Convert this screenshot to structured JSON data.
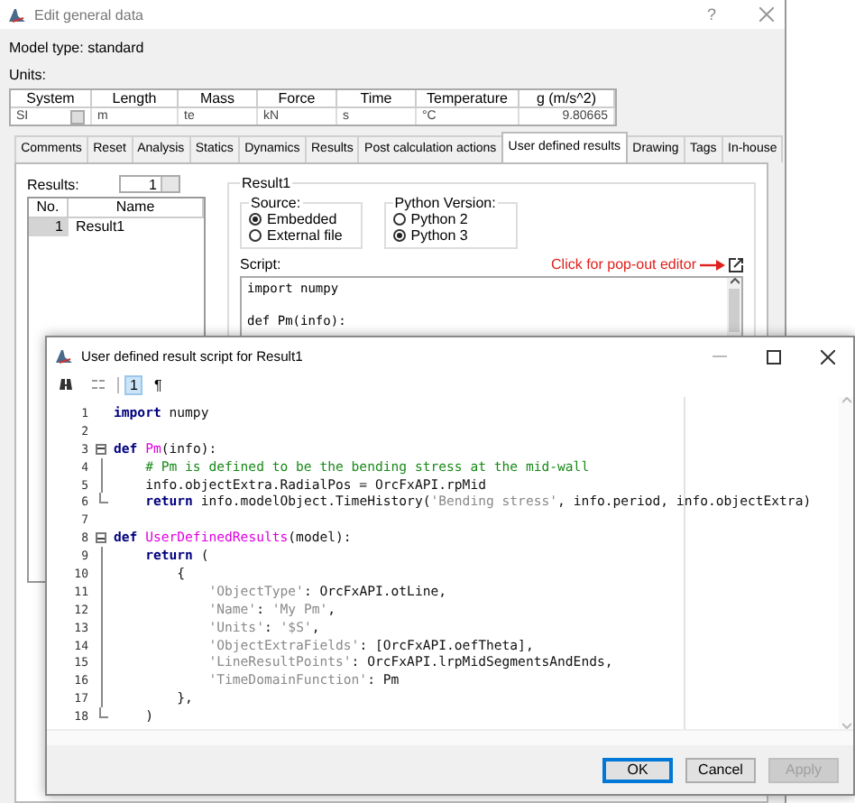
{
  "main_window": {
    "title": "Edit general data",
    "help": "?",
    "model_type": "Model type: standard",
    "units_label": "Units:",
    "units": [
      {
        "header": "System",
        "value": "SI",
        "kind": "dropdown"
      },
      {
        "header": "Length",
        "value": "m",
        "kind": "text"
      },
      {
        "header": "Mass",
        "value": "te",
        "kind": "text"
      },
      {
        "header": "Force",
        "value": "kN",
        "kind": "text"
      },
      {
        "header": "Time",
        "value": "s",
        "kind": "text"
      },
      {
        "header": "Temperature",
        "value": "°C",
        "kind": "text"
      },
      {
        "header": "g (m/s^2)",
        "value": "9.80665",
        "kind": "number"
      }
    ],
    "tabs": [
      {
        "label": "Comments",
        "selected": false
      },
      {
        "label": "Reset",
        "selected": false
      },
      {
        "label": "Analysis",
        "selected": false
      },
      {
        "label": "Statics",
        "selected": false
      },
      {
        "label": "Dynamics",
        "selected": false
      },
      {
        "label": "Results",
        "selected": false
      },
      {
        "label": "Post calculation actions",
        "selected": false
      },
      {
        "label": "User defined results",
        "selected": true
      },
      {
        "label": "Drawing",
        "selected": false
      },
      {
        "label": "Tags",
        "selected": false
      },
      {
        "label": "In-house",
        "selected": false
      }
    ],
    "results_label": "Results:",
    "results_count": "1",
    "results_list": {
      "columns": [
        "No.",
        "Name"
      ],
      "rows": [
        {
          "no": "1",
          "name": "Result1",
          "selected": true
        }
      ]
    },
    "result_group": {
      "title": "Result1",
      "source": {
        "title": "Source:",
        "options": [
          {
            "label": "Embedded",
            "selected": true
          },
          {
            "label": "External file",
            "selected": false
          }
        ]
      },
      "python_version": {
        "title": "Python Version:",
        "options": [
          {
            "label": "Python 2",
            "selected": false
          },
          {
            "label": "Python 3",
            "selected": true
          }
        ]
      },
      "script_label": "Script:",
      "popout_hint": "Click for pop-out editor",
      "script_blocks": [
        [
          "import numpy"
        ],
        [
          "def Pm(info):"
        ]
      ]
    }
  },
  "editor_window": {
    "title": "User defined result script for Result1",
    "toolbar": [
      {
        "kind": "find",
        "selected": false
      },
      {
        "kind": "replace",
        "selected": false
      },
      {
        "kind": "toggle",
        "label": "1",
        "selected": true
      },
      {
        "kind": "toggle",
        "label": "¶",
        "selected": false
      }
    ],
    "lines": [
      {
        "number": "1",
        "kind": "plain",
        "tokens": [
          {
            "kind": "keyword",
            "text": "import"
          },
          {
            "kind": "plain",
            "text": " numpy"
          }
        ]
      },
      {
        "number": "2",
        "kind": "plain"
      },
      {
        "number": "3",
        "kind": "fold_start",
        "tokens": [
          {
            "kind": "keyword",
            "text": "def "
          },
          {
            "kind": "function",
            "text": "Pm"
          },
          {
            "kind": "plain",
            "text": "(info):"
          }
        ]
      },
      {
        "number": "4",
        "kind": "fold_body",
        "tokens": [
          {
            "kind": "comment",
            "text": "    # Pm is defined to be the bending stress at the mid-wall"
          }
        ]
      },
      {
        "number": "5",
        "kind": "fold_body",
        "tokens": [
          {
            "kind": "plain",
            "text": "    info.objectExtra.RadialPos = OrcFxAPI.rpMid"
          }
        ]
      },
      {
        "number": "6",
        "kind": "fold_end",
        "tokens": [
          {
            "kind": "keyword",
            "text": "    return"
          },
          {
            "kind": "plain",
            "text": " info.modelObject.TimeHistory("
          },
          {
            "kind": "string",
            "text": "'Bending stress'"
          },
          {
            "kind": "plain",
            "text": ", info.period, info.objectExtra)"
          }
        ]
      },
      {
        "number": "7",
        "kind": "plain"
      },
      {
        "number": "8",
        "kind": "fold_start",
        "tokens": [
          {
            "kind": "keyword",
            "text": "def "
          },
          {
            "kind": "function",
            "text": "UserDefinedResults"
          },
          {
            "kind": "plain",
            "text": "(model):"
          }
        ]
      },
      {
        "number": "9",
        "kind": "fold_body",
        "tokens": [
          {
            "kind": "keyword",
            "text": "    return"
          },
          {
            "kind": "plain",
            "text": " ("
          }
        ]
      },
      {
        "number": "10",
        "kind": "fold_body",
        "tokens": [
          {
            "kind": "plain",
            "text": "        {"
          }
        ]
      },
      {
        "number": "11",
        "kind": "fold_body",
        "tokens": [
          {
            "kind": "string",
            "text": "            'ObjectType'"
          },
          {
            "kind": "plain",
            "text": ": OrcFxAPI.otLine,"
          }
        ]
      },
      {
        "number": "12",
        "kind": "fold_body",
        "tokens": [
          {
            "kind": "string",
            "text": "            'Name'"
          },
          {
            "kind": "plain",
            "text": ": "
          },
          {
            "kind": "string",
            "text": "'My Pm'"
          },
          {
            "kind": "plain",
            "text": ","
          }
        ]
      },
      {
        "number": "13",
        "kind": "fold_body",
        "tokens": [
          {
            "kind": "string",
            "text": "            'Units'"
          },
          {
            "kind": "plain",
            "text": ": "
          },
          {
            "kind": "string",
            "text": "'$S'"
          },
          {
            "kind": "plain",
            "text": ","
          }
        ]
      },
      {
        "number": "14",
        "kind": "fold_body",
        "tokens": [
          {
            "kind": "string",
            "text": "            'ObjectExtraFields'"
          },
          {
            "kind": "plain",
            "text": ": [OrcFxAPI.oefTheta],"
          }
        ]
      },
      {
        "number": "15",
        "kind": "fold_body",
        "tokens": [
          {
            "kind": "string",
            "text": "            'LineResultPoints'"
          },
          {
            "kind": "plain",
            "text": ": OrcFxAPI.lrpMidSegmentsAndEnds,"
          }
        ]
      },
      {
        "number": "16",
        "kind": "fold_body",
        "tokens": [
          {
            "kind": "string",
            "text": "            'TimeDomainFunction'"
          },
          {
            "kind": "plain",
            "text": ": Pm"
          }
        ]
      },
      {
        "number": "17",
        "kind": "fold_body",
        "tokens": [
          {
            "kind": "plain",
            "text": "        },"
          }
        ]
      },
      {
        "number": "18",
        "kind": "fold_end",
        "tokens": [
          {
            "kind": "plain",
            "text": "    )"
          }
        ]
      }
    ],
    "buttons": [
      {
        "label": "OK",
        "default": true,
        "disabled": false
      },
      {
        "label": "Cancel",
        "default": false,
        "disabled": false
      },
      {
        "label": "Apply",
        "default": false,
        "disabled": true
      }
    ]
  }
}
